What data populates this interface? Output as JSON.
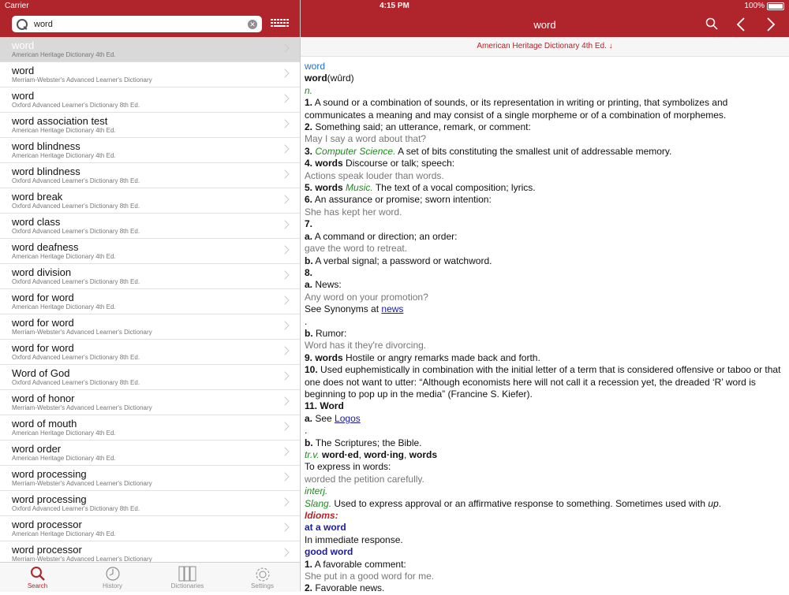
{
  "status_bar": {
    "carrier": "Carrier",
    "time": "4:15 PM",
    "battery": "100%"
  },
  "search": {
    "value": "word"
  },
  "results": [
    {
      "term": "word",
      "source": "American Heritage Dictionary 4th Ed.",
      "selected": true
    },
    {
      "term": "word",
      "source": "Merriam-Webster's Advanced Learner's Dictionary"
    },
    {
      "term": "word",
      "source": "Oxford Advanced Learner's Dictionary 8th Ed."
    },
    {
      "term": "word association test",
      "source": "American Heritage Dictionary 4th Ed."
    },
    {
      "term": "word blindness",
      "source": "American Heritage Dictionary 4th Ed."
    },
    {
      "term": "word blindness",
      "source": "Oxford Advanced Learner's Dictionary 8th Ed."
    },
    {
      "term": "word break",
      "source": "Oxford Advanced Learner's Dictionary 8th Ed."
    },
    {
      "term": "word class",
      "source": "Oxford Advanced Learner's Dictionary 8th Ed."
    },
    {
      "term": "word deafness",
      "source": "American Heritage Dictionary 4th Ed."
    },
    {
      "term": "word division",
      "source": "Oxford Advanced Learner's Dictionary 8th Ed."
    },
    {
      "term": "word for word",
      "source": "American Heritage Dictionary 4th Ed."
    },
    {
      "term": "word for word",
      "source": "Merriam-Webster's Advanced Learner's Dictionary"
    },
    {
      "term": "word for word",
      "source": "Oxford Advanced Learner's Dictionary 8th Ed."
    },
    {
      "term": "Word of God",
      "source": "Oxford Advanced Learner's Dictionary 8th Ed."
    },
    {
      "term": "word of honor",
      "source": "Merriam-Webster's Advanced Learner's Dictionary"
    },
    {
      "term": "word of mouth",
      "source": "American Heritage Dictionary 4th Ed."
    },
    {
      "term": "word order",
      "source": "American Heritage Dictionary 4th Ed."
    },
    {
      "term": "word processing",
      "source": "Merriam-Webster's Advanced Learner's Dictionary"
    },
    {
      "term": "word processing",
      "source": "Oxford Advanced Learner's Dictionary 8th Ed."
    },
    {
      "term": "word processor",
      "source": "American Heritage Dictionary 4th Ed."
    },
    {
      "term": "word processor",
      "source": "Merriam-Webster's Advanced Learner's Dictionary"
    },
    {
      "term": "word processor",
      "source": ""
    }
  ],
  "tabs": [
    {
      "label": "Search",
      "icon": "search-icon",
      "active": true
    },
    {
      "label": "History",
      "icon": "clock-icon"
    },
    {
      "label": "Dictionaries",
      "icon": "books-icon"
    },
    {
      "label": "Settings",
      "icon": "gear-icon"
    }
  ],
  "entry": {
    "nav_title": "word",
    "source": "American Heritage Dictionary 4th Ed. ↓",
    "headword": "word",
    "pron_word": "word",
    "pron": "(wûrd)",
    "pos": "n.",
    "d1_num": "1.",
    "d1": " A sound or a combination of sounds, or its representation in writing or printing, that symbolizes and communicates a meaning and may consist of a single morpheme or of a combination of morphemes.",
    "d2_num": "2.",
    "d2": " Something said; an utterance, remark, or comment:",
    "d2_ex": "May I say a word about that?",
    "d3_num": "3.",
    "d3_field": "Computer Science.",
    "d3": " A set of bits constituting the smallest unit of addressable memory.",
    "d4_num": "4. words",
    "d4": " Discourse or talk; speech:",
    "d4_ex": "Actions speak louder than words.",
    "d5_num": "5. words",
    "d5_field": "Music.",
    "d5": " The text of a vocal composition; lyrics.",
    "d6_num": "6.",
    "d6": " An assurance or promise; sworn intention:",
    "d6_ex": "She has kept her word.",
    "d7_num": "7.",
    "d7a_num": "a.",
    "d7a": " A command or direction; an order:",
    "d7a_ex": "gave the word to retreat.",
    "d7b_num": "b.",
    "d7b": " A verbal signal; a password or watchword.",
    "d8_num": "8.",
    "d8a_num": "a.",
    "d8a": " News:",
    "d8a_ex": "Any word on your promotion?",
    "d8a_syn": "See Synonyms at ",
    "d8a_link": "news",
    "dot": ".",
    "d8b_num": "b.",
    "d8b": " Rumor:",
    "d8b_ex": "Word has it they're divorcing.",
    "d9_num": "9. words",
    "d9": " Hostile or angry remarks made back and forth.",
    "d10_num": "10.",
    "d10": " Used euphemistically in combination with the initial letter of a term that is considered offensive or taboo or that one does not want to utter: “Although economists here will not call it a recession yet, the dreaded ‘R’ word is beginning to pop up in the media” (Francine S. Kiefer).",
    "d11_num": "11. Word",
    "d11a_num": "a.",
    "d11a": " See ",
    "d11a_link": "Logos",
    "d11b_num": "b.",
    "d11b": " The Scriptures; the Bible.",
    "tv_pos": "tr.v.",
    "tv_forms_1": " word·ed",
    "tv_sep1": ", ",
    "tv_forms_2": "word·ing",
    "tv_sep2": ", ",
    "tv_forms_3": "words",
    "tv_def": "To express in words:",
    "tv_ex": "worded the petition carefully.",
    "interj_pos": "interj.",
    "slang_field": "Slang.",
    "slang": " Used to express approval or an affirmative response to something. Sometimes used with ",
    "slang_up": "up",
    "slang_end": ".",
    "idioms": "Idioms:",
    "idiom1": "at a word",
    "idiom1_def": "In immediate response.",
    "idiom2": "good word",
    "idiom2_d1_num": "1.",
    "idiom2_d1": " A favorable comment:",
    "idiom2_d1_ex": "She put in a good word for me.",
    "idiom2_d2_num": "2.",
    "idiom2_d2": " Favorable news."
  },
  "colors": {
    "brand": "#b0252c",
    "example": "#777777",
    "field": "#1e8a1e",
    "link": "#1a1aa6"
  }
}
